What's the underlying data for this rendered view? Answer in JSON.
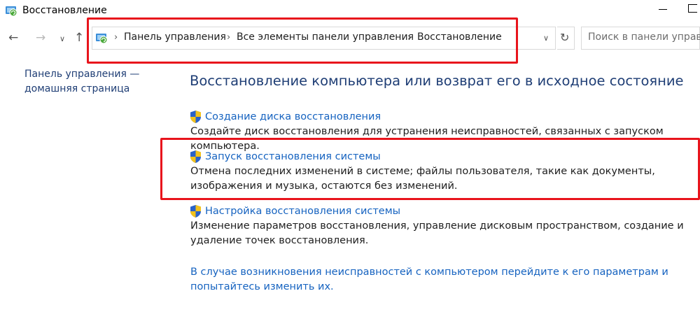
{
  "window": {
    "title": "Восстановление"
  },
  "nav": {
    "back_icon": "arrow-left-icon",
    "forward_icon": "arrow-right-icon",
    "recent_icon": "chevron-down-icon",
    "up_icon": "arrow-up-icon"
  },
  "address": {
    "crumbs": [
      "Панель управления",
      "Все элементы панели управления",
      "Восстановление"
    ],
    "separator": "›"
  },
  "search": {
    "placeholder": "Поиск в панели управле"
  },
  "sidebar": {
    "home_link": "Панель управления — домашняя страница"
  },
  "main": {
    "heading": "Восстановление компьютера или возврат его в исходное состояние",
    "items": [
      {
        "link": "Создание диска восстановления",
        "description": "Создайте диск восстановления для устранения неисправностей, связанных с запуском компьютера."
      },
      {
        "link": "Запуск восстановления системы",
        "description": "Отмена последних изменений в системе; файлы пользователя, такие как документы, изображения и музыка, остаются без изменений."
      },
      {
        "link": "Настройка восстановления системы",
        "description": "Изменение параметров восстановления, управление дисковым пространством, создание и удаление точек восстановления."
      }
    ],
    "footer_link": "В случае возникновения неисправностей с компьютером перейдите к его параметрам и попытайтесь изменить их."
  },
  "colors": {
    "highlight": "#e8141c",
    "link": "#1663c0",
    "heading": "#1f3e75"
  }
}
